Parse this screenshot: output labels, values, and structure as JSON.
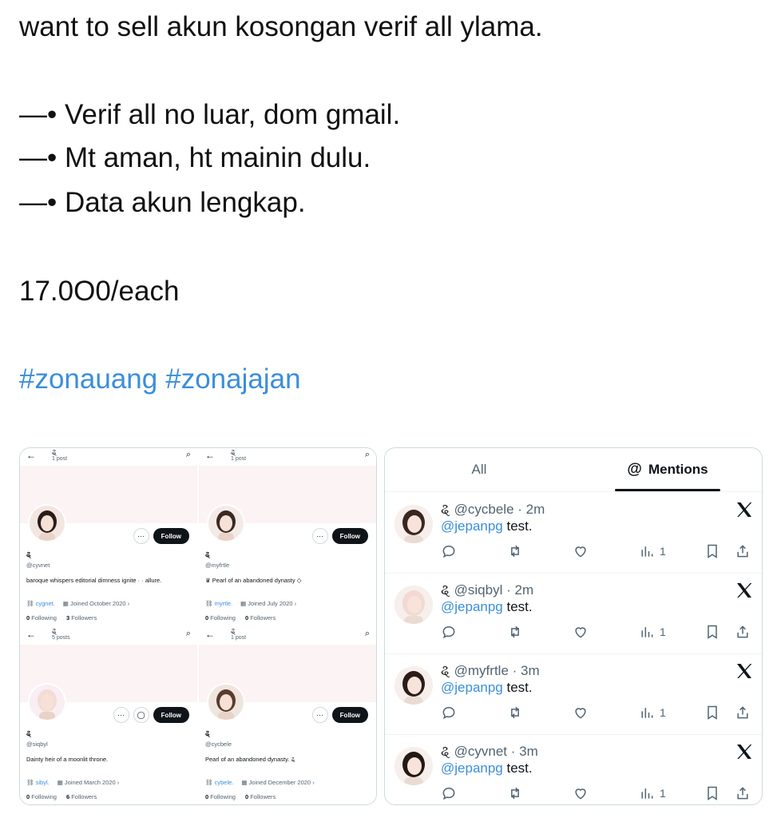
{
  "tweet": {
    "line1": "want to sell akun kosongan verif all ylama.",
    "bullets": [
      "—• Verif all no luar, dom gmail.",
      "—• Mt aman, ht mainin dulu.",
      "—• Data akun lengkap."
    ],
    "price": "17.0O0/each",
    "hashtags": [
      "#zonauang",
      "#zonajajan"
    ]
  },
  "profiles": [
    {
      "top_name": "ୡ",
      "posts": "1 post",
      "display_name": "ୡ",
      "handle": "@cyvnet",
      "bio": "baroque  whispers  editorial  dimness  ignite  ·  ·  allure.",
      "link": "cygnet.",
      "joined": "Joined October 2020",
      "following": "0",
      "followers": "3",
      "following_label": "Following",
      "followers_label": "Followers",
      "follow_label": "Follow"
    },
    {
      "top_name": "ୡ",
      "posts": "1 post",
      "display_name": "ୡ",
      "handle": "@myfrtle",
      "bio": "♛ Pearl of an abandoned dynasty ◇",
      "link": "myrtle.",
      "joined": "Joined July 2020",
      "following": "0",
      "followers": "0",
      "following_label": "Following",
      "followers_label": "Followers",
      "follow_label": "Follow"
    },
    {
      "top_name": "ୡ",
      "posts": "5 posts",
      "display_name": "ୡ",
      "handle": "@siqbyl",
      "bio": "Dainty heir of a moonlit throne.",
      "link": "sibyl.",
      "joined": "Joined March 2020",
      "following": "0",
      "followers": "6",
      "following_label": "Following",
      "followers_label": "Followers",
      "follow_label": "Follow"
    },
    {
      "top_name": "ୡ",
      "posts": "1 post",
      "display_name": "ୡ",
      "handle": "@cycbele",
      "bio": "Pearl of an abandoned dynasty. ୡ",
      "link": "cybele.",
      "joined": "Joined December 2020",
      "following": "0",
      "followers": "0",
      "following_label": "Following",
      "followers_label": "Followers",
      "follow_label": "Follow"
    }
  ],
  "notifications_panel": {
    "tabs": [
      {
        "label": "All"
      },
      {
        "label": "Mentions"
      }
    ],
    "mention_icon": "@",
    "items": [
      {
        "name": "ୡ",
        "handle": "@cycbele",
        "time": "· 2m",
        "mention": "@jepanpg",
        "text": "test.",
        "views": "1"
      },
      {
        "name": "ୡ",
        "handle": "@siqbyl",
        "time": "· 2m",
        "mention": "@jepanpg",
        "text": "test.",
        "views": "1"
      },
      {
        "name": "ୡ",
        "handle": "@myfrtle",
        "time": "· 3m",
        "mention": "@jepanpg",
        "text": "test.",
        "views": "1"
      },
      {
        "name": "ୡ",
        "handle": "@cyvnet",
        "time": "· 3m",
        "mention": "@jepanpg",
        "text": "test.",
        "views": "1"
      }
    ]
  },
  "colors": {
    "accent": "#3b8edb",
    "text": "#0f1419",
    "muted": "#536471",
    "border": "#cfd9de"
  }
}
